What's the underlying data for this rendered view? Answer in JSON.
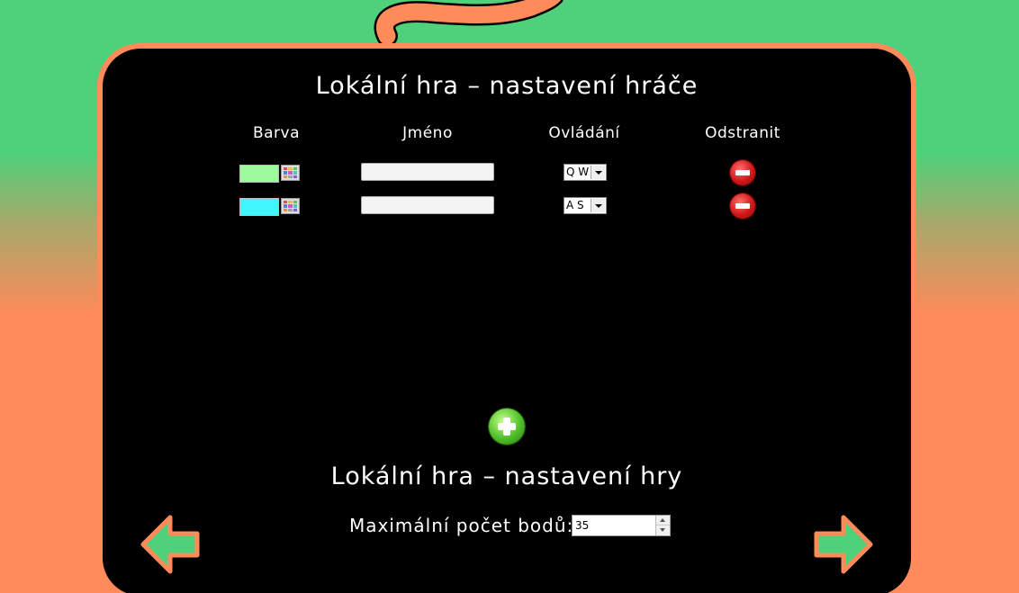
{
  "header": {
    "title_players": "Lokální hra – nastavení hráče",
    "title_game": "Lokální hra – nastavení hry"
  },
  "columns": {
    "color": "Barva",
    "name": "Jméno",
    "controls": "Ovládání",
    "remove": "Odstranit"
  },
  "players": [
    {
      "color": "#9dfb9d",
      "name": "",
      "controls": "Q W"
    },
    {
      "color": "#3ff5ff",
      "name": "",
      "controls": "A S"
    }
  ],
  "settings": {
    "max_points_label": "Maximální počet bodů:",
    "max_points_value": "35"
  },
  "colors": {
    "background_top": "#4fd07a",
    "background_bottom": "#ff8a5a",
    "panel": "#000000",
    "panel_border": "#ff8a5a",
    "arrow_fill": "#4fd07a"
  },
  "icons": {
    "remove": "remove-circle-icon",
    "add": "add-circle-icon",
    "back": "arrow-left-icon",
    "next": "arrow-right-icon",
    "palette": "color-palette-icon"
  }
}
